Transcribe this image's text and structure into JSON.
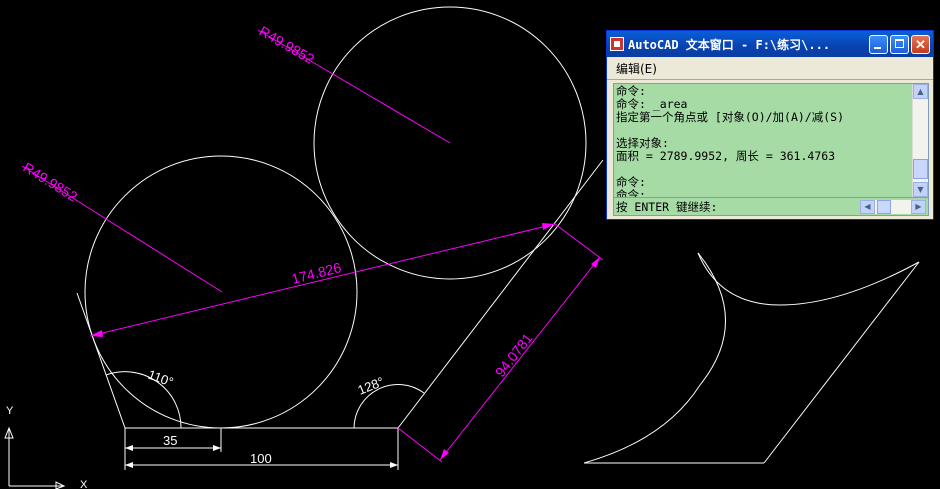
{
  "drawing": {
    "dimensions": {
      "radius_1": "R49.9852",
      "radius_2": "R49.9852",
      "aligned_long": "174.826",
      "aligned_slant": "94.0781",
      "angle_left": "110°",
      "angle_right": "128°",
      "linear_small": "35",
      "linear_base": "100"
    },
    "ucs": {
      "x_label": "X",
      "y_label": "Y"
    },
    "colors": {
      "background": "#000000",
      "geometry": "#ffffff",
      "dimensions": "#ff00ff"
    }
  },
  "text_window": {
    "title": "AutoCAD 文本窗口 - F:\\练习\\...",
    "menu": {
      "edit": "编辑(E)"
    },
    "lines": [
      "命令:",
      "命令: _area",
      "指定第一个角点或 [对象(O)/加(A)/减(S)",
      "",
      "选择对象:",
      "面积 = 2789.9952, 周长 = 361.4763",
      "",
      "命令:",
      "命令:"
    ],
    "prompt": "按 ENTER 键继续:",
    "colors": {
      "console_bg": "#a6dba6",
      "title_bar": "#0a5fd8"
    }
  }
}
